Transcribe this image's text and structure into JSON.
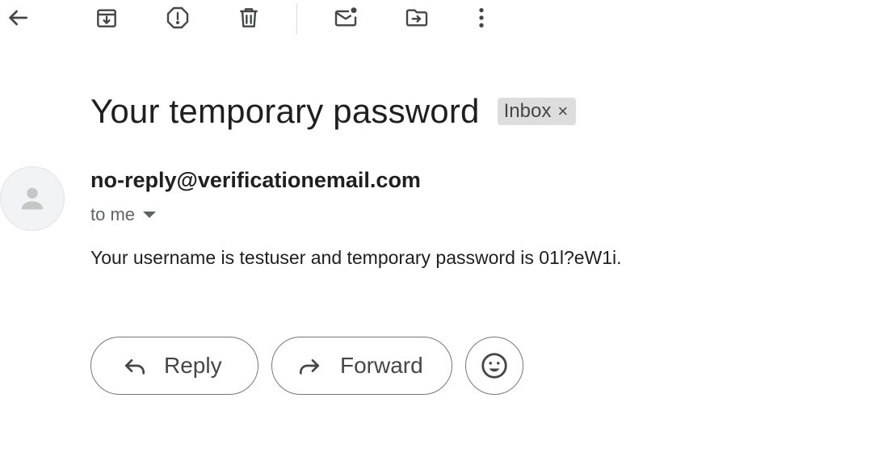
{
  "toolbar": {
    "back": "back-arrow-icon",
    "archive": "archive-icon",
    "report_spam": "report-spam-icon",
    "delete": "trash-icon",
    "mark_unread": "mark-unread-icon",
    "move_to": "move-to-folder-icon",
    "more": "more-vert-icon"
  },
  "email": {
    "subject": "Your temporary password",
    "label": "Inbox",
    "label_remove": "×",
    "sender": "no-reply@verificationemail.com",
    "recipient": "to me",
    "body": "Your username is testuser and temporary password is 01l?eW1i."
  },
  "actions": {
    "reply_label": "Reply",
    "forward_label": "Forward",
    "emoji": "emoji-reaction-icon"
  },
  "colors": {
    "icon": "#444746",
    "chip_bg": "#dddddd",
    "avatar_bg": "#f1f3f4",
    "button_border": "#747775"
  }
}
